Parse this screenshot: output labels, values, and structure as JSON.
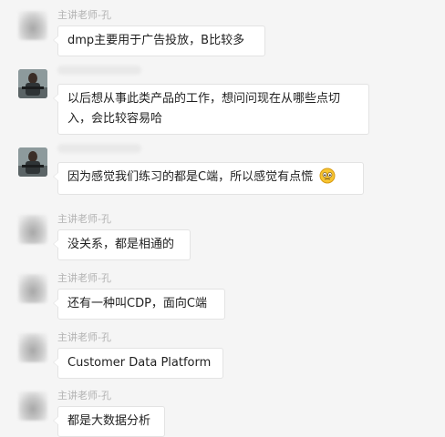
{
  "messages": [
    {
      "sender": "主讲老师-孔",
      "text": "dmp主要用于广告投放，B比较多",
      "avatar": "blurred-avatar"
    },
    {
      "sender": "",
      "text": "以后想从事此类产品的工作，想问问现在从哪些点切入，会比较容易哈",
      "avatar": "soldier-photo-avatar"
    },
    {
      "sender": "",
      "text": "因为感觉我们练习的都是C端，所以感觉有点慌",
      "avatar": "soldier-photo-avatar",
      "emoji": "nervous-face-emoji"
    },
    {
      "sender": "主讲老师-孔",
      "text": "没关系，都是相通的",
      "avatar": "blurred-avatar"
    },
    {
      "sender": "主讲老师-孔",
      "text": "还有一种叫CDP，面向C端",
      "avatar": "blurred-avatar"
    },
    {
      "sender": "主讲老师-孔",
      "text": "Customer Data Platform",
      "avatar": "blurred-avatar"
    },
    {
      "sender": "主讲老师-孔",
      "text": "都是大数据分析",
      "avatar": "blurred-avatar"
    }
  ]
}
